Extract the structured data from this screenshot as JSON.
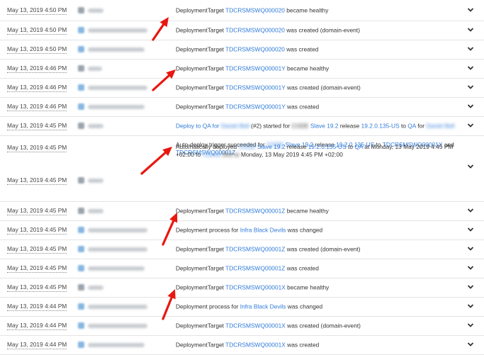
{
  "events": [
    {
      "date": "May 13, 2019 4:50 PM",
      "avatar": "dark",
      "uname_w": 22,
      "parts": [
        {
          "t": "DeploymentTarget "
        },
        {
          "t": "TDCRSMSWQ000020",
          "c": "link"
        },
        {
          "t": " became healthy"
        }
      ]
    },
    {
      "date": "May 13, 2019 4:50 PM",
      "avatar": "blue",
      "uname_w": 84,
      "parts": [
        {
          "t": "DeploymentTarget "
        },
        {
          "t": "TDCRSMSWQ000020",
          "c": "link"
        },
        {
          "t": " was created (domain-event)"
        }
      ]
    },
    {
      "date": "May 13, 2019 4:50 PM",
      "avatar": "blue",
      "uname_w": 80,
      "parts": [
        {
          "t": "DeploymentTarget "
        },
        {
          "t": "TDCRSMSWQ000020",
          "c": "link"
        },
        {
          "t": " was created"
        }
      ]
    },
    {
      "date": "May 13, 2019 4:46 PM",
      "avatar": "dark",
      "uname_w": 20,
      "parts": [
        {
          "t": "DeploymentTarget "
        },
        {
          "t": "TDCRSMSWQ00001Y",
          "c": "link"
        },
        {
          "t": " became healthy"
        }
      ]
    },
    {
      "date": "May 13, 2019 4:46 PM",
      "avatar": "blue",
      "uname_w": 84,
      "parts": [
        {
          "t": "DeploymentTarget "
        },
        {
          "t": "TDCRSMSWQ00001Y",
          "c": "link"
        },
        {
          "t": " was created (domain-event)"
        }
      ]
    },
    {
      "date": "May 13, 2019 4:46 PM",
      "avatar": "blue",
      "uname_w": 80,
      "parts": [
        {
          "t": "DeploymentTarget "
        },
        {
          "t": "TDCRSMSWQ00001Y",
          "c": "link"
        },
        {
          "t": " was created"
        }
      ]
    },
    {
      "date": "May 13, 2019 4:45 PM",
      "avatar": "dark",
      "uname_w": 22,
      "parts": [
        {
          "t": "Deploy to QA for ",
          "c": "link"
        },
        {
          "t": "Daniel Bell",
          "c": "link blur"
        },
        {
          "t": " (#2) started for "
        },
        {
          "t": "CODE",
          "c": "blur"
        },
        {
          "t": " "
        },
        {
          "t": "Slave 19.2",
          "c": "link"
        },
        {
          "t": " release "
        },
        {
          "t": "19.2.0.135-US",
          "c": "link"
        },
        {
          "t": " to "
        },
        {
          "t": "QA",
          "c": "link"
        },
        {
          "t": " for "
        },
        {
          "t": "Daniel Bell",
          "c": "link blur"
        }
      ]
    },
    {
      "date": "May 13, 2019 4:45 PM",
      "avatar": "dark",
      "uname_w": 0,
      "top": true,
      "parts": [
        {
          "t": "Auto-deploy trigger succeeded for "
        },
        {
          "t": "CODE",
          "c": "link blur"
        },
        {
          "t": " "
        },
        {
          "t": "Slave 19.2",
          "c": "link"
        },
        {
          "t": " release "
        },
        {
          "t": "19.2.0.135-US",
          "c": "link"
        },
        {
          "t": " to "
        },
        {
          "t": "TDCRSMSWQ00001X",
          "c": "link"
        },
        {
          "t": " and "
        },
        {
          "t": "TDCRSMSWQ00001Z",
          "c": "link"
        }
      ]
    },
    {
      "date": "May 13, 2019 4:45 PM",
      "avatar": "dark",
      "uname_w": 22,
      "bottom": true,
      "parts": [
        {
          "t": "Automatically deployed "
        },
        {
          "t": "CODE",
          "c": "link blur"
        },
        {
          "t": " "
        },
        {
          "t": "Slave 19.2",
          "c": "link"
        },
        {
          "t": " release "
        },
        {
          "t": "19.2.0.135-US",
          "c": "link"
        },
        {
          "t": " to "
        },
        {
          "t": "QA",
          "c": "link"
        },
        {
          "t": " at Monday, 13 May 2019 4:45 PM +02:00 fo"
        },
        {
          "t": "r Daniel",
          "c": "link blur"
        },
        {
          "t": " "
        },
        {
          "t": "Bell at",
          "c": "blur"
        },
        {
          "t": " Monday, 13 May 2019 4:45 PM +02:00"
        }
      ]
    },
    {
      "date": "May 13, 2019 4:45 PM",
      "avatar": "dark",
      "uname_w": 22,
      "parts": [
        {
          "t": "DeploymentTarget "
        },
        {
          "t": "TDCRSMSWQ00001Z",
          "c": "link"
        },
        {
          "t": " became healthy"
        }
      ]
    },
    {
      "date": "May 13, 2019 4:45 PM",
      "avatar": "blue",
      "uname_w": 84,
      "parts": [
        {
          "t": "Deployment process for "
        },
        {
          "t": "Infra Black Devils",
          "c": "link"
        },
        {
          "t": " was changed"
        }
      ]
    },
    {
      "date": "May 13, 2019 4:45 PM",
      "avatar": "blue",
      "uname_w": 84,
      "parts": [
        {
          "t": "DeploymentTarget "
        },
        {
          "t": "TDCRSMSWQ00001Z",
          "c": "link"
        },
        {
          "t": " was created (domain-event)"
        }
      ]
    },
    {
      "date": "May 13, 2019 4:45 PM",
      "avatar": "blue",
      "uname_w": 80,
      "parts": [
        {
          "t": "DeploymentTarget "
        },
        {
          "t": "TDCRSMSWQ00001Z",
          "c": "link"
        },
        {
          "t": " was created"
        }
      ]
    },
    {
      "date": "May 13, 2019 4:45 PM",
      "avatar": "dark",
      "uname_w": 22,
      "parts": [
        {
          "t": "DeploymentTarget "
        },
        {
          "t": "TDCRSMSWQ00001X",
          "c": "link"
        },
        {
          "t": " became healthy"
        }
      ]
    },
    {
      "date": "May 13, 2019 4:44 PM",
      "avatar": "blue",
      "uname_w": 84,
      "parts": [
        {
          "t": "Deployment process for "
        },
        {
          "t": "Infra Black Devils",
          "c": "link"
        },
        {
          "t": " was changed"
        }
      ]
    },
    {
      "date": "May 13, 2019 4:44 PM",
      "avatar": "blue",
      "uname_w": 84,
      "parts": [
        {
          "t": "DeploymentTarget "
        },
        {
          "t": "TDCRSMSWQ00001X",
          "c": "link"
        },
        {
          "t": " was created (domain-event)"
        }
      ]
    },
    {
      "date": "May 13, 2019 4:44 PM",
      "avatar": "blue",
      "uname_w": 80,
      "parts": [
        {
          "t": "DeploymentTarget "
        },
        {
          "t": "TDCRSMSWQ00001X",
          "c": "link"
        },
        {
          "t": " was created"
        }
      ]
    }
  ],
  "icons": {
    "row_toggle": "chevron-down-icon",
    "annotation": "red-arrow-icon"
  },
  "colors": {
    "link": "#2f7bd8",
    "text": "#333333",
    "divider": "#e4e4e4",
    "arrow": "#e8170f"
  }
}
